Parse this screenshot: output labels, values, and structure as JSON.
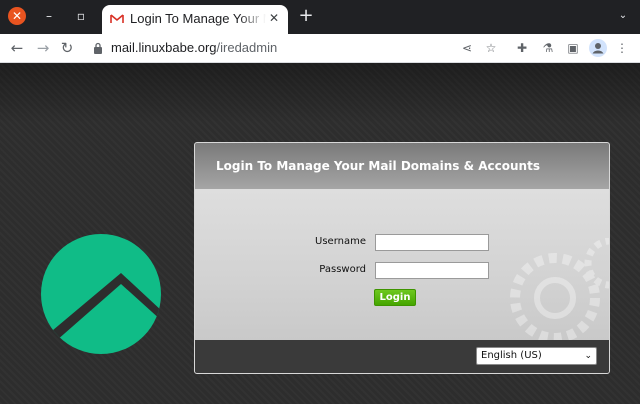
{
  "browser": {
    "tab": {
      "title": "Login To Manage Your Mail Domains & Accounts"
    },
    "address": {
      "domain": "mail.linuxbabe.org",
      "path": "/iredadmin"
    }
  },
  "login": {
    "title": "Login To Manage Your Mail Domains & Accounts",
    "username_label": "Username",
    "username_value": "",
    "password_label": "Password",
    "password_value": "",
    "button_label": "Login"
  },
  "language": {
    "selected": "English (US)"
  },
  "icons": {
    "close": "close-icon",
    "minimize": "minimize-icon",
    "maximize": "maximize-icon",
    "favicon": "gmail-favicon-icon",
    "tab_close": "tab-close-icon",
    "new_tab": "plus-icon",
    "tab_search": "chevron-down-icon",
    "back": "back-arrow-icon",
    "forward": "forward-arrow-icon",
    "reload": "reload-icon",
    "lock": "lock-icon",
    "share": "share-icon",
    "bookmark": "star-icon",
    "extensions": "puzzle-icon",
    "labs": "flask-icon",
    "side_panel": "side-panel-icon",
    "profile": "profile-icon",
    "menu": "kebab-menu-icon"
  },
  "colors": {
    "ubuntu_close": "#e95420",
    "logo_green": "#10bc87",
    "login_button": "#4caf0a"
  }
}
